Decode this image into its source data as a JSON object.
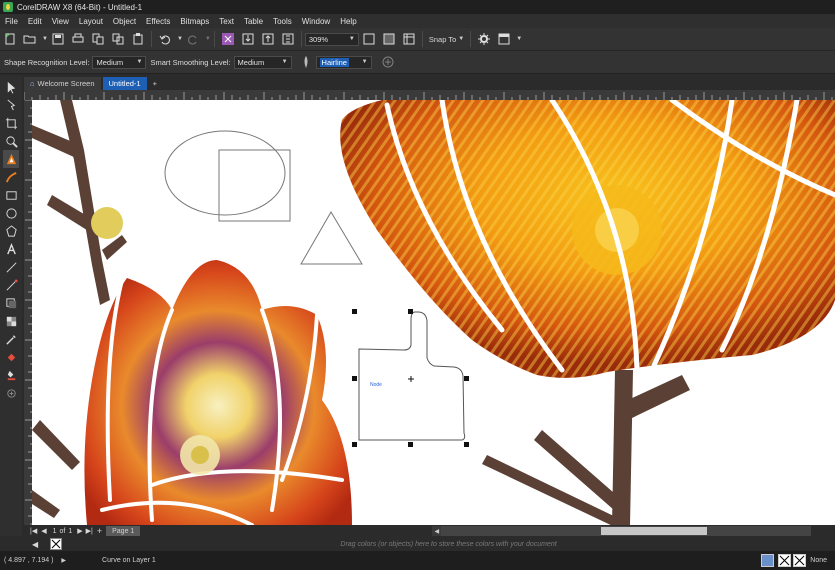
{
  "window": {
    "title": "CorelDRAW X8 (64-Bit) - Untitled-1"
  },
  "menu": [
    "File",
    "Edit",
    "View",
    "Layout",
    "Object",
    "Effects",
    "Bitmaps",
    "Text",
    "Table",
    "Tools",
    "Window",
    "Help"
  ],
  "toolbar": {
    "zoom": "309%",
    "snap_label": "Snap To"
  },
  "propbar": {
    "shape_recognition_label": "Shape Recognition Level:",
    "shape_recognition_value": "Medium",
    "smart_smoothing_label": "Smart Smoothing Level:",
    "smart_smoothing_value": "Medium",
    "outline_value": "Hairline"
  },
  "tabs": [
    {
      "label": "Welcome Screen"
    },
    {
      "label": "Untitled-1"
    }
  ],
  "canvas": {
    "node_label": "Node"
  },
  "pagenav": {
    "current": "1",
    "of": "of",
    "total": "1",
    "page_tab": "Page 1"
  },
  "palette": {
    "hint": "Drag colors (or objects) here to store these colors with your document"
  },
  "status": {
    "coords": "( 4.897 , 7.194 )",
    "object_info": "Curve on Layer 1",
    "fill_label": "None"
  },
  "colors": {
    "accent": "#1c5fb4",
    "stem": "#5a4035",
    "dot": "#e2cd5c"
  }
}
